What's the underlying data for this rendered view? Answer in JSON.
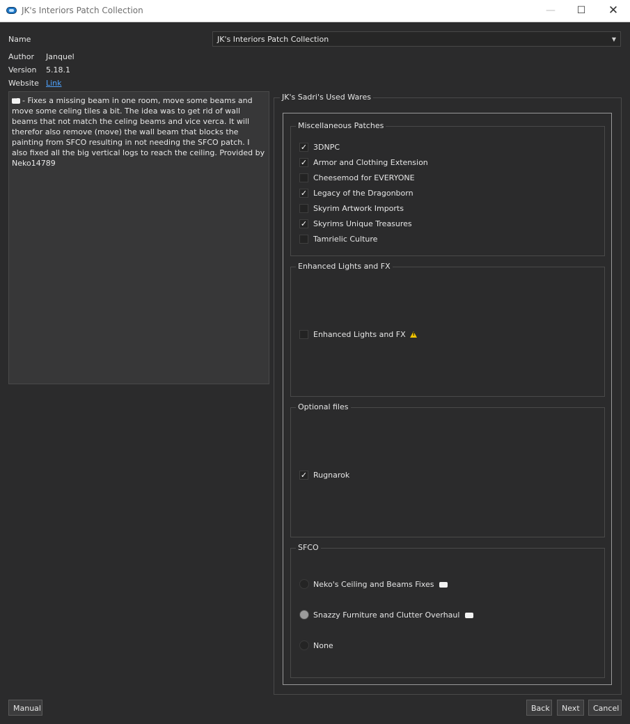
{
  "window": {
    "title": "JK's Interiors Patch Collection"
  },
  "info": {
    "name_label": "Name",
    "name_value": "JK's Interiors Patch Collection",
    "author_label": "Author",
    "author_value": "Janquel",
    "version_label": "Version",
    "version_value": "5.18.1",
    "website_label": "Website",
    "website_link": "Link"
  },
  "description": "- Fixes a missing beam in one room, move some beams and move some celing tiles a bit. The idea was to get rid of wall beams that not match the celing beams and vice verca. It will therefor also remove (move) the wall beam that blocks the painting from SFCO resulting in not needing the SFCO patch. I also fixed all the big vertical logs to reach the ceiling. Provided by Neko14789",
  "step": {
    "title": "JK's Sadri's Used Wares",
    "groups": [
      {
        "title": "Miscellaneous Patches",
        "options": [
          {
            "label": "3DNPC",
            "checked": true
          },
          {
            "label": "Armor and Clothing Extension",
            "checked": true
          },
          {
            "label": "Cheesemod for EVERYONE",
            "checked": false
          },
          {
            "label": "Legacy of the Dragonborn",
            "checked": true
          },
          {
            "label": "Skyrim Artwork Imports",
            "checked": false
          },
          {
            "label": "Skyrims Unique Treasures",
            "checked": true
          },
          {
            "label": "Tamrielic Culture",
            "checked": false
          }
        ]
      },
      {
        "title": "Enhanced Lights and FX",
        "options": [
          {
            "label": "Enhanced Lights and FX",
            "checked": false,
            "icon": "warning-icon"
          }
        ]
      },
      {
        "title": "Optional files",
        "options": [
          {
            "label": "Rugnarok",
            "checked": true
          }
        ]
      },
      {
        "title": "SFCO",
        "options": [
          {
            "label": "Neko's Ceiling and Beams Fixes",
            "selected": false,
            "icon": "comment-icon"
          },
          {
            "label": "Snazzy Furniture and Clutter Overhaul",
            "selected": true,
            "icon": "comment-icon"
          },
          {
            "label": "None",
            "selected": false
          }
        ]
      }
    ]
  },
  "check_glyph": "✓",
  "buttons": {
    "manual": "Manual",
    "back": "Back",
    "next": "Next",
    "cancel": "Cancel"
  }
}
